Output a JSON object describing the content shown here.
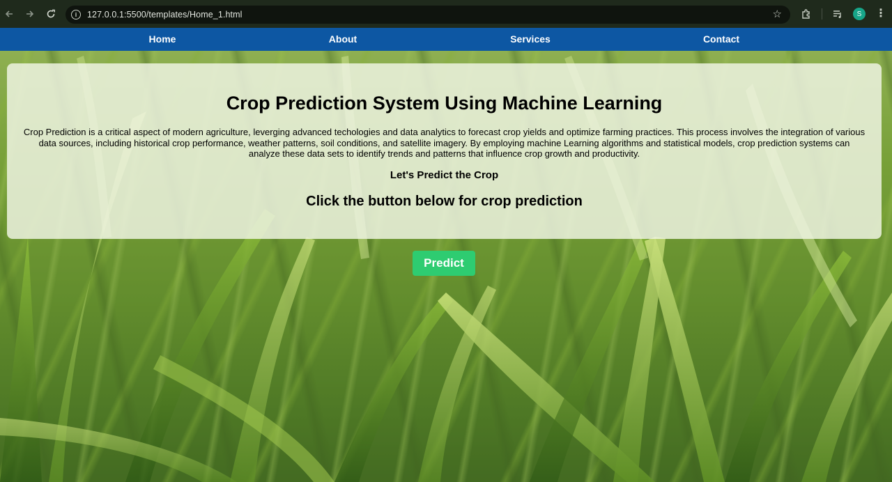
{
  "browser": {
    "url": "127.0.0.1:5500/templates/Home_1.html",
    "profile_initial": "S"
  },
  "nav": {
    "items": [
      {
        "label": "Home"
      },
      {
        "label": "About"
      },
      {
        "label": "Services"
      },
      {
        "label": "Contact"
      }
    ]
  },
  "hero": {
    "title": "Crop Prediction System Using Machine Learning",
    "description": "Crop Prediction is a critical aspect of modern agriculture, leverging advanced techologies and data analytics to forecast crop yields and optimize farming practices. This process involves the integration of various data sources, including historical crop performance, weather patterns, soil conditions, and satellite imagery. By employing machine Learning algorithms and statistical models, crop prediction systems can analyze these data sets to identify trends and patterns that influence crop growth and productivity.",
    "subheading": "Let's Predict the Crop",
    "cta_text": "Click the button below for crop prediction"
  },
  "actions": {
    "predict_label": "Predict"
  },
  "colors": {
    "nav_bg": "#0d57a3",
    "predict_bg": "#2ecc71",
    "browser_bg": "#1f2a1c",
    "avatar_bg": "#17a589"
  },
  "icons": {
    "back": "arrow-left-icon",
    "forward": "arrow-right-icon",
    "reload": "reload-icon",
    "site_info": "info-icon",
    "bookmark": "star-icon",
    "extensions": "puzzle-icon",
    "media": "media-control-icon",
    "menu": "kebab-menu-icon"
  }
}
